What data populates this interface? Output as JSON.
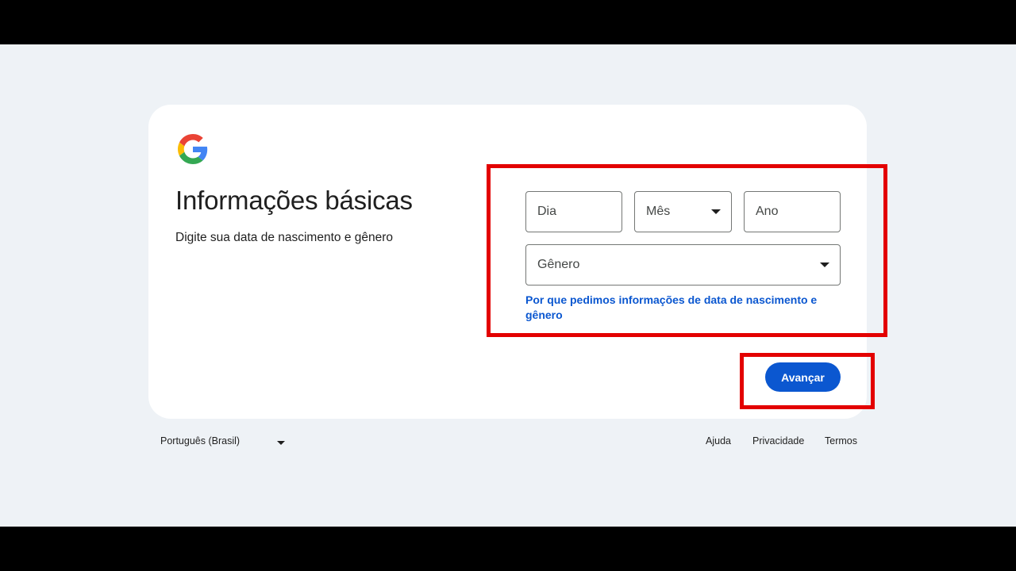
{
  "card": {
    "title": "Informações básicas",
    "subtitle": "Digite sua data de nascimento e gênero"
  },
  "form": {
    "day_placeholder": "Dia",
    "month_label": "Mês",
    "year_placeholder": "Ano",
    "gender_label": "Gênero",
    "why_link": "Por que pedimos informações de data de nascimento e gênero"
  },
  "actions": {
    "next_label": "Avançar"
  },
  "footer": {
    "language": "Português (Brasil)",
    "help": "Ajuda",
    "privacy": "Privacidade",
    "terms": "Termos"
  },
  "icons": {
    "logo": "google-g-logo",
    "dropdown": "chevron-down-icon"
  },
  "colors": {
    "accent": "#0b57d0",
    "highlight": "#e30000",
    "background": "#eef2f6"
  }
}
